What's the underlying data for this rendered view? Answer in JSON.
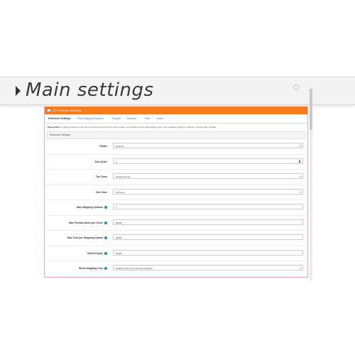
{
  "banner": {
    "title": "Main settings"
  },
  "panel": {
    "header_title": "LEX Products Shipping",
    "tabs": [
      {
        "label": "Extension Settings",
        "active": true
      },
      {
        "label": "Free Shipping Products",
        "active": false
      },
      {
        "label": "Plugins",
        "active": false
      },
      {
        "label": "Modules",
        "active": false
      },
      {
        "label": "Tools",
        "active": false
      },
      {
        "label": "About",
        "active": false
      }
    ],
    "note_prefix": "Please Note:",
    "note_text": "If certain products in the store will not be covered for by this module, you should provide a flat shipping rate in the modules Shipping, methods, unsupported modules.",
    "section_title": "Extension Settings",
    "fields": [
      {
        "label": "Status",
        "value": "Enabled",
        "type": "select"
      },
      {
        "label": "Sort Order",
        "value": "0",
        "type": "text-trash"
      },
      {
        "label": "Tax Class",
        "value": "Taxable Goods",
        "type": "select"
      },
      {
        "label": "Geo Zone",
        "value": "All Zones",
        "type": "select"
      },
      {
        "label": "Max Shipping Options",
        "value": "3",
        "type": "text",
        "help": true
      },
      {
        "label": "Max Product Items per Order",
        "value": "99999",
        "type": "text",
        "help": true
      },
      {
        "label": "Max Cost per Shipping Option",
        "value": "99999",
        "type": "text",
        "help": true
      },
      {
        "label": "Cache Expiry",
        "value": "10000",
        "type": "text",
        "help": true
      },
      {
        "label": "Show Shipping Cost",
        "value": "Enabled Show Time Estimate (Default)",
        "type": "select",
        "help": true
      }
    ]
  }
}
